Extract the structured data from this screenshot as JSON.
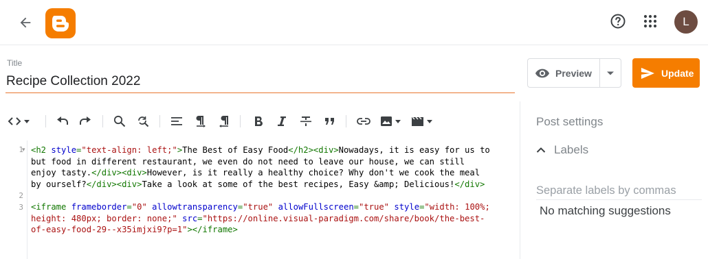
{
  "header": {
    "icons": {
      "back": "arrow-left-icon",
      "logo": "blogger-logo",
      "help": "help-circle-icon",
      "apps": "apps-grid-icon"
    },
    "avatar_initial": "L",
    "avatar_color": "#6d4c41",
    "brand_color": "#f57d00"
  },
  "editor_header": {
    "title_label": "Title",
    "title_value": "Recipe Collection 2022",
    "preview_label": "Preview",
    "update_label": "Update"
  },
  "toolbar": {
    "items": [
      "view-mode",
      "undo",
      "redo",
      "search",
      "find-replace",
      "align",
      "paragraph-ltr",
      "paragraph-rtl",
      "bold",
      "italic",
      "strikethrough",
      "quote",
      "link",
      "insert-image",
      "insert-video"
    ]
  },
  "code": {
    "line_numbers": [
      "1",
      "2",
      "3"
    ],
    "line1": [
      {
        "t": "tag",
        "s": "<h2 "
      },
      {
        "t": "attr",
        "s": "style"
      },
      {
        "t": "tag",
        "s": "="
      },
      {
        "t": "str",
        "s": "\"text-align: left;\""
      },
      {
        "t": "tag",
        "s": ">"
      },
      {
        "t": "txt",
        "s": "The Best of Easy Food"
      },
      {
        "t": "tag",
        "s": "</h2><div>"
      },
      {
        "t": "txt",
        "s": "Nowadays, it is easy for us to"
      }
    ],
    "line1b": [
      {
        "t": "txt",
        "s": "but food in different restaurant, we even do not need to leave our house, we can still"
      }
    ],
    "line1c": [
      {
        "t": "txt",
        "s": "enjoy tasty."
      },
      {
        "t": "tag",
        "s": "</div><div>"
      },
      {
        "t": "txt",
        "s": "However, is it really a healthy choice? Why don't we cook the meal"
      }
    ],
    "line1d": [
      {
        "t": "txt",
        "s": "by ourself?"
      },
      {
        "t": "tag",
        "s": "</div><div>"
      },
      {
        "t": "txt",
        "s": "Take a look at some of the best recipes, Easy &amp; Delicious!"
      },
      {
        "t": "tag",
        "s": "</div>"
      }
    ],
    "line3": [
      {
        "t": "tag",
        "s": "<iframe "
      },
      {
        "t": "attr",
        "s": "frameborder"
      },
      {
        "t": "tag",
        "s": "="
      },
      {
        "t": "str",
        "s": "\"0\""
      },
      {
        "t": "txt",
        "s": " "
      },
      {
        "t": "attr",
        "s": "allowtransparency"
      },
      {
        "t": "tag",
        "s": "="
      },
      {
        "t": "str",
        "s": "\"true\""
      },
      {
        "t": "txt",
        "s": " "
      },
      {
        "t": "attr",
        "s": "allowFullscreen"
      },
      {
        "t": "tag",
        "s": "="
      },
      {
        "t": "str",
        "s": "\"true\""
      },
      {
        "t": "txt",
        "s": " "
      },
      {
        "t": "attr",
        "s": "style"
      },
      {
        "t": "tag",
        "s": "="
      },
      {
        "t": "str",
        "s": "\"width: 100%;"
      }
    ],
    "line3b": [
      {
        "t": "str",
        "s": "height: 480px; border: none;\""
      },
      {
        "t": "txt",
        "s": " "
      },
      {
        "t": "attr",
        "s": "src"
      },
      {
        "t": "tag",
        "s": "="
      },
      {
        "t": "str",
        "s": "\"https://online.visual-paradigm.com/share/book/the-best-"
      }
    ],
    "line3c": [
      {
        "t": "str",
        "s": "of-easy-food-29--x35imjxi9?p=1\""
      },
      {
        "t": "tag",
        "s": "></iframe>"
      }
    ]
  },
  "side_panel": {
    "title": "Post settings",
    "labels_heading": "Labels",
    "labels_placeholder": "Separate labels by commas",
    "no_match": "No matching suggestions"
  }
}
